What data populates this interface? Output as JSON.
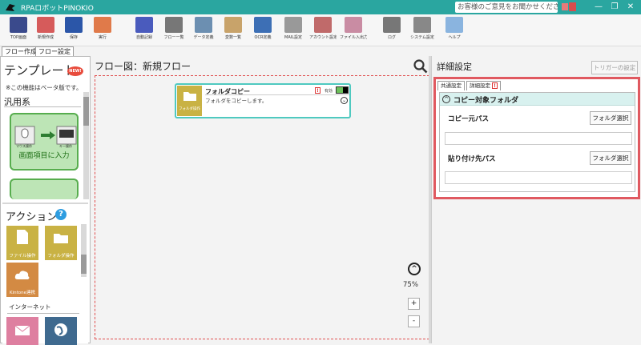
{
  "window": {
    "title": "RPAロボットPINOKIO",
    "feedback": "お客様のご意見をお聞かせください",
    "controls": [
      "—",
      "❐",
      "✕"
    ]
  },
  "toolbar": {
    "items": [
      {
        "label": "TOP画面",
        "icon": "top-screen-icon",
        "color": "#3a4a8c"
      },
      {
        "label": "新規作成",
        "icon": "new-file-icon",
        "color": "#d65b5b"
      },
      {
        "label": "保存",
        "icon": "save-icon",
        "color": "#2b56a8"
      },
      {
        "label": "実行",
        "icon": "run-icon",
        "color": "#e07a4a"
      },
      {
        "label": "自動記録",
        "icon": "auto-record-icon",
        "color": "#4a5bbd"
      },
      {
        "label": "フロー一覧",
        "icon": "flow-list-icon",
        "color": "#777777"
      },
      {
        "label": "データ定義",
        "icon": "data-definition-icon",
        "color": "#6c8fb1"
      },
      {
        "label": "変数一覧",
        "icon": "variable-list-icon",
        "color": "#c8a36a"
      },
      {
        "label": "OCR定義",
        "icon": "ocr-definition-icon",
        "color": "#3d6fb5"
      },
      {
        "label": "MAIL設定",
        "icon": "mail-settings-icon",
        "color": "#999999"
      },
      {
        "label": "アカウント設定",
        "icon": "account-settings-icon",
        "color": "#c06a6a"
      },
      {
        "label": "ファイル入出力",
        "icon": "file-io-icon",
        "color": "#c98ca3"
      },
      {
        "label": "ログ",
        "icon": "log-icon",
        "color": "#777777"
      },
      {
        "label": "システム設定",
        "icon": "system-settings-icon",
        "color": "#888888"
      },
      {
        "label": "ヘルプ",
        "icon": "help-icon",
        "color": "#8ab4df"
      }
    ]
  },
  "tabs": {
    "flow_create": "フロー作成",
    "flow_settings": "フロー設定"
  },
  "left": {
    "template_title": "テンプレート",
    "new_badge": "NEW!",
    "beta_note": "※この機能はベータ版です。",
    "general": "汎用系",
    "template_card": "画面項目に入力",
    "template_icon_left": "マウス操作",
    "template_icon_right": "キー操作",
    "actions_title": "アクション",
    "actions_help": "?",
    "actions": [
      {
        "label": "ファイル操作",
        "color": "#c9b244"
      },
      {
        "label": "フォルダ操作",
        "color": "#c9b244"
      },
      {
        "label": "Kintone連携",
        "color": "#d38a43"
      }
    ],
    "internet": "インターネット"
  },
  "center": {
    "title": "フロー図：新規フロー",
    "node": {
      "title": "フォルダコピー",
      "desc": "フォルダをコピーします。",
      "folder_label": "フォルダ操作",
      "enabled": "有効",
      "warn": "!"
    },
    "zoom": "75%",
    "zoom_in": "+",
    "zoom_out": "-"
  },
  "right": {
    "title": "詳細設定",
    "trigger_button": "トリガーの設定",
    "tab_common": "共通設定",
    "tab_detail": "詳細設定",
    "warn": "!",
    "section_title": "コピー対象フォルダ",
    "source_label": "コピー元パス",
    "dest_label": "貼り付け先パス",
    "select_button": "フォルダ選択",
    "source_value": "",
    "dest_value": ""
  }
}
